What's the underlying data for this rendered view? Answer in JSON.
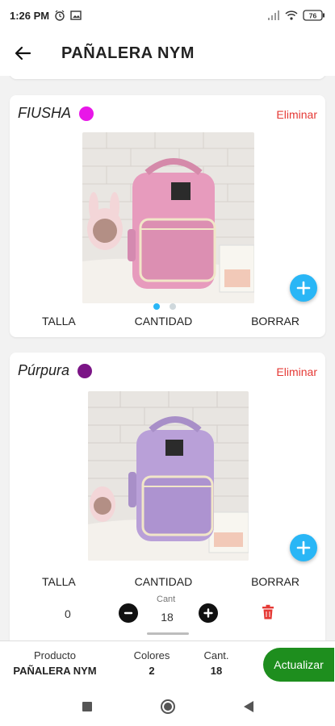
{
  "status": {
    "time": "1:26 PM",
    "battery": "76",
    "icons": [
      "alarm-icon",
      "image-icon",
      "signal-icon",
      "wifi-icon",
      "battery-icon"
    ]
  },
  "header": {
    "title": "PAÑALERA  NYM",
    "back_icon": "arrow-left-icon"
  },
  "variants": [
    {
      "name": "FIUSHA",
      "swatch": "#e817e8",
      "delete_label": "Eliminar",
      "bag_color": "#e79bbd",
      "columns": [
        "TALLA",
        "CANTIDAD",
        "BORRAR"
      ],
      "carousel_pages": 2,
      "carousel_active": 0
    },
    {
      "name": "Púrpura",
      "swatch": "#7b1586",
      "delete_label": "Eliminar",
      "bag_color": "#b9a0d8",
      "columns": [
        "TALLA",
        "CANTIDAD",
        "BORRAR"
      ],
      "rows": [
        {
          "size": "0",
          "qty_label": "Cant",
          "qty": "18"
        }
      ]
    }
  ],
  "footer": {
    "product_label": "Producto",
    "product_value": "PAÑALERA  NYM",
    "colors_label": "Colores",
    "colors_value": "2",
    "qty_label": "Cant.",
    "qty_value": "18",
    "update_label": "Actualizar"
  },
  "colors": {
    "accent": "#29b6f6",
    "danger": "#e53935",
    "primary_button": "#1e8e1e"
  }
}
